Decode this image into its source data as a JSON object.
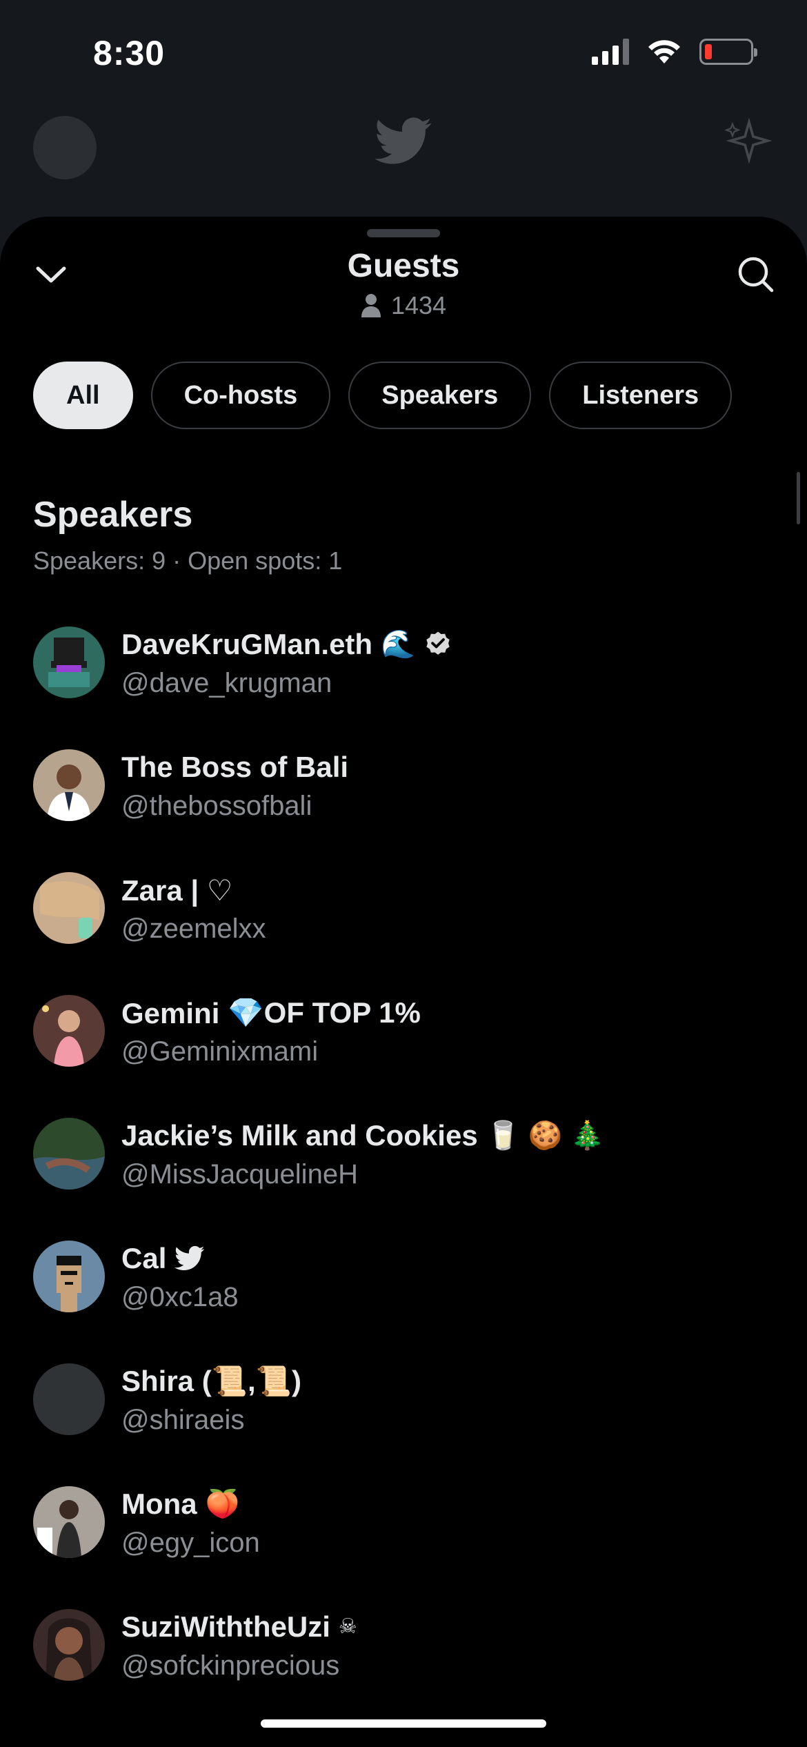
{
  "status": {
    "time": "8:30"
  },
  "sheet": {
    "title": "Guests",
    "listener_count": "1434"
  },
  "tabs": [
    {
      "label": "All",
      "active": true
    },
    {
      "label": "Co-hosts",
      "active": false
    },
    {
      "label": "Speakers",
      "active": false
    },
    {
      "label": "Listeners",
      "active": false
    }
  ],
  "section": {
    "title": "Speakers",
    "subtitle": "Speakers: 9 · Open spots: 1"
  },
  "speakers": [
    {
      "name": "DaveKruGMan.eth",
      "emoji": "🌊",
      "badge": "verified-icon",
      "handle": "@dave_krugman",
      "avatar_color": "#2f6b5f"
    },
    {
      "name": "The Boss of Bali",
      "emoji": "",
      "badge": "",
      "handle": "@thebossofbali",
      "avatar_color": "#7a6a58"
    },
    {
      "name": "Zara | ♡",
      "emoji": "",
      "badge": "",
      "handle": "@zeemelxx",
      "avatar_color": "#b89a7e"
    },
    {
      "name": "Gemini",
      "emoji": "💎OF TOP 1%",
      "badge": "",
      "handle": "@Geminixmami",
      "avatar_color": "#8c5a4f"
    },
    {
      "name": "Jackie’s Milk and Cookies",
      "emoji": "🥛 🍪 🎄",
      "badge": "",
      "handle": "@MissJacquelineH",
      "avatar_color": "#3f5a3a"
    },
    {
      "name": "Cal",
      "emoji": "",
      "badge": "twitter-bird-icon",
      "handle": "@0xc1a8",
      "avatar_color": "#6a8aa6"
    },
    {
      "name": "Shira (📜,📜)",
      "emoji": "",
      "badge": "",
      "handle": "@shiraeis",
      "avatar_color": "#2f3336"
    },
    {
      "name": "Mona",
      "emoji": "🍑",
      "badge": "",
      "handle": "@egy_icon",
      "avatar_color": "#9b9590"
    },
    {
      "name": "SuziWiththeUzi",
      "emoji": "☠",
      "badge": "",
      "handle": "@sofckinprecious",
      "avatar_color": "#6e4a3a"
    }
  ]
}
